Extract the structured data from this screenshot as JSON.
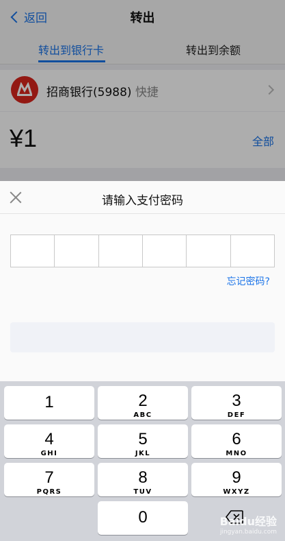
{
  "nav": {
    "back_label": "返回",
    "title": "转出"
  },
  "tabs": [
    {
      "label": "转出到银行卡",
      "active": true
    },
    {
      "label": "转出到余额",
      "active": false
    }
  ],
  "bank": {
    "name": "招商银行(5988)",
    "tag": "快捷"
  },
  "amount": {
    "value": "¥1",
    "all_label": "全部"
  },
  "sheet": {
    "title": "请输入支付密码",
    "forgot_label": "忘记密码?",
    "password_length": 6
  },
  "keypad": {
    "keys": [
      {
        "num": "1",
        "letters": ""
      },
      {
        "num": "2",
        "letters": "ABC"
      },
      {
        "num": "3",
        "letters": "DEF"
      },
      {
        "num": "4",
        "letters": "GHI"
      },
      {
        "num": "5",
        "letters": "JKL"
      },
      {
        "num": "6",
        "letters": "MNO"
      },
      {
        "num": "7",
        "letters": "PQRS"
      },
      {
        "num": "8",
        "letters": "TUV"
      },
      {
        "num": "9",
        "letters": "WXYZ"
      },
      {
        "num": "0",
        "letters": ""
      }
    ]
  },
  "watermark": {
    "text": "Baidu经验",
    "sub": "jingyan.baidu.com"
  },
  "colors": {
    "accent": "#1a73e8",
    "bank_logo": "#d9261c"
  }
}
